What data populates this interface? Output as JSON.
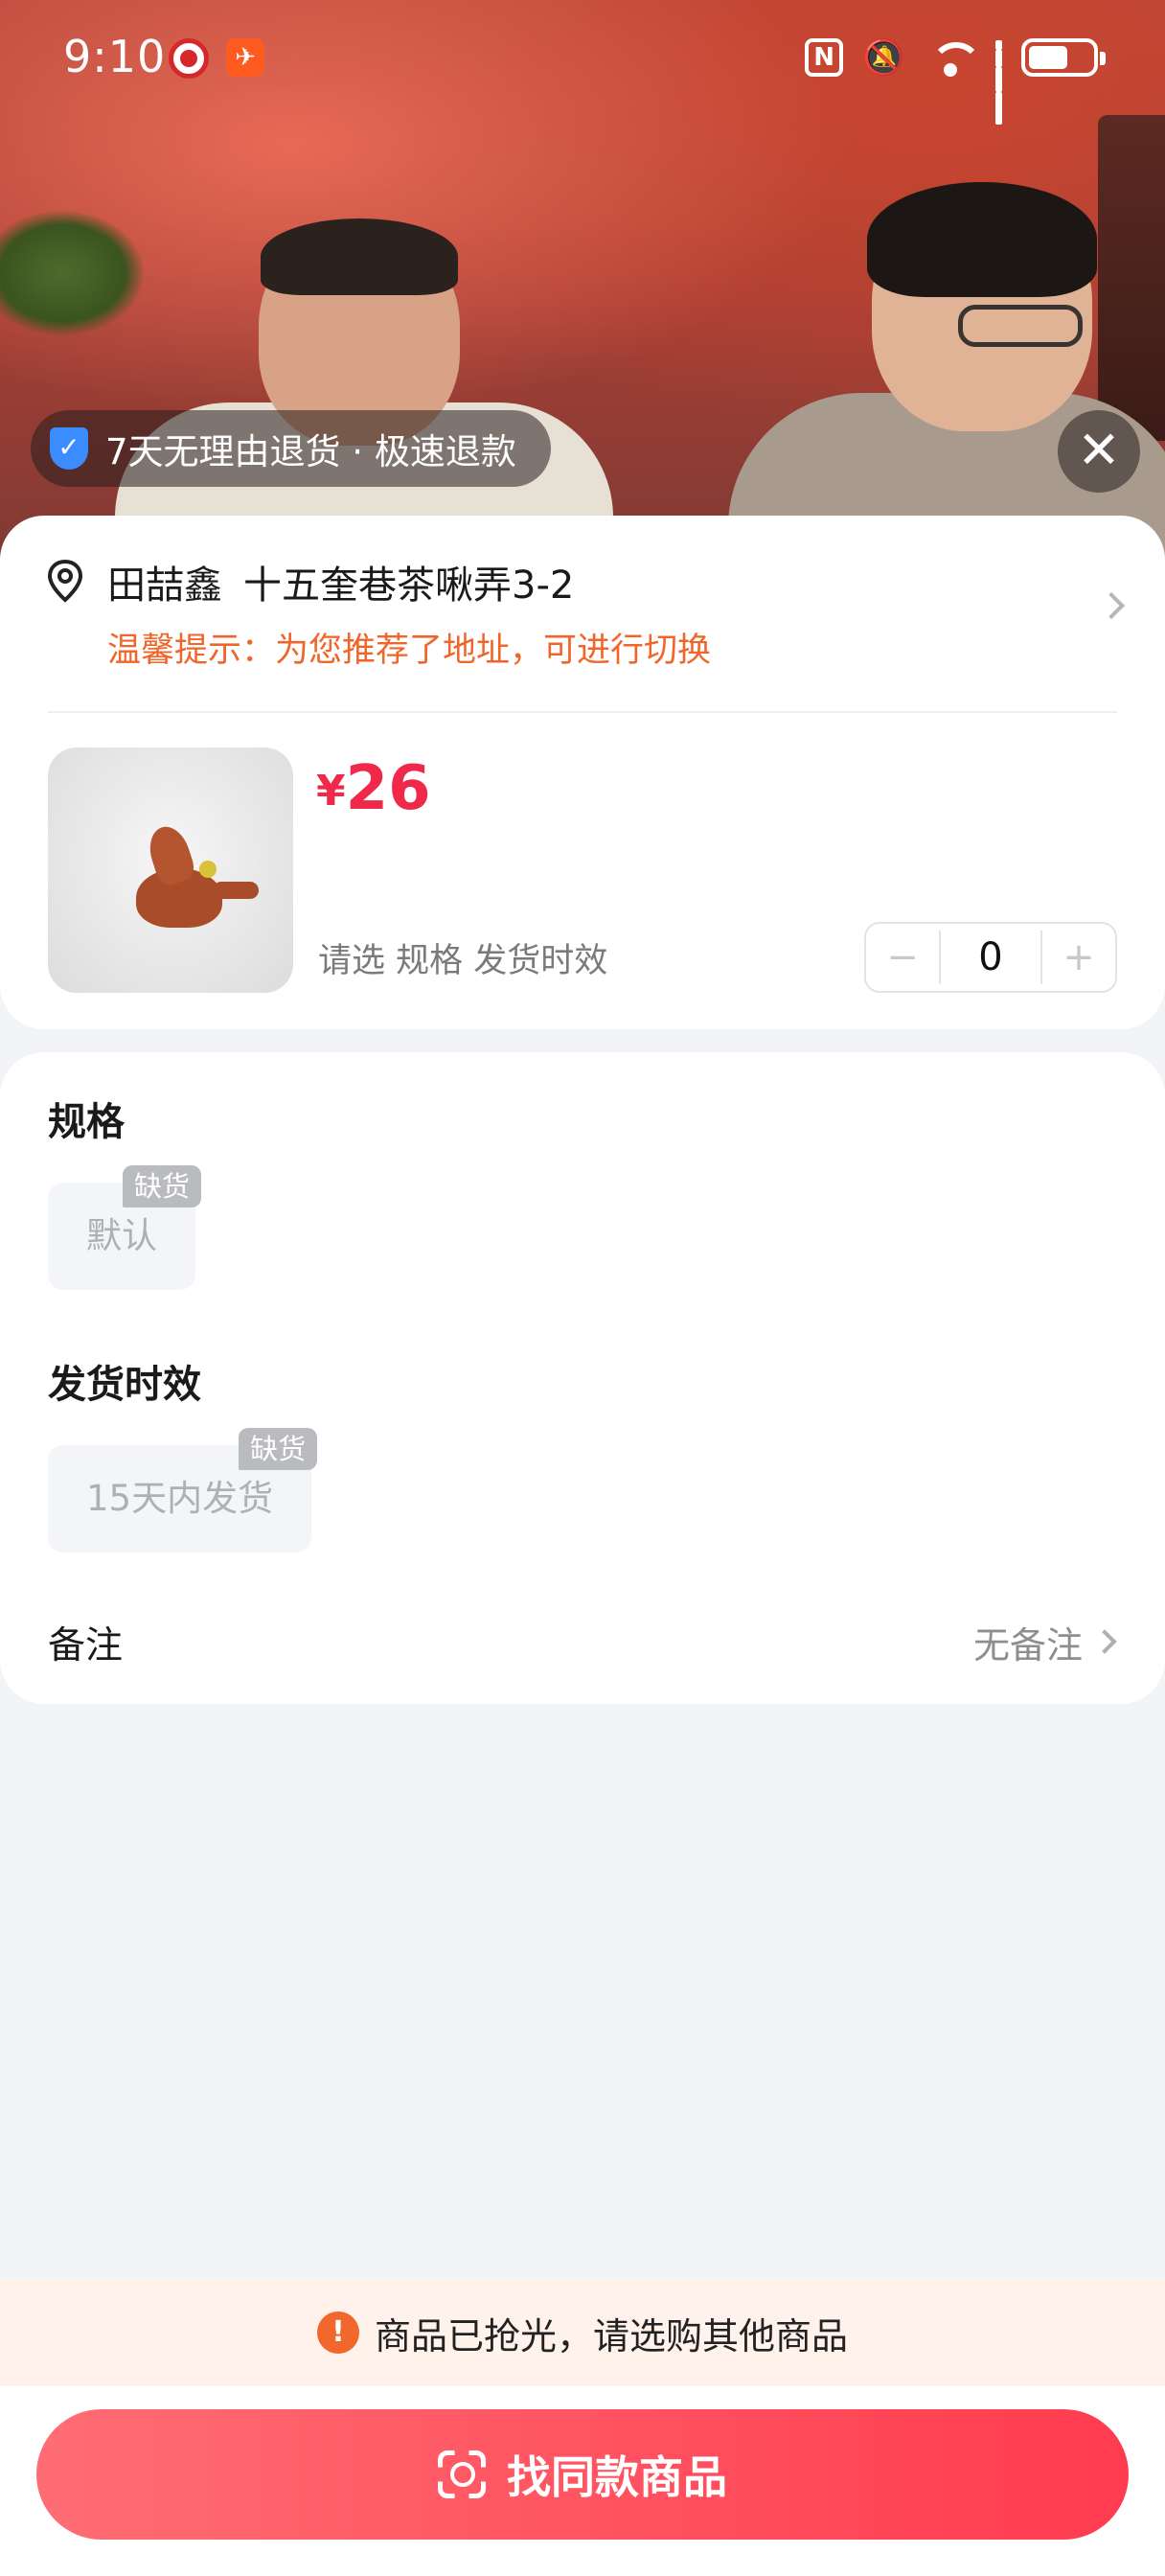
{
  "status_bar": {
    "time": "9:10",
    "icons": [
      "china-citic-app-icon",
      "orange-app-icon",
      "nfc-icon",
      "mute-bell-icon",
      "wifi-icon",
      "signal-icon",
      "battery-icon"
    ]
  },
  "video": {
    "return_badge": "7天无理由退货 · 极速退款",
    "close_icon": "close-icon"
  },
  "address": {
    "name": "田喆鑫",
    "detail": "十五奎巷茶啾弄3-2",
    "tip": "温馨提示：为您推荐了地址，可进行切换"
  },
  "product": {
    "currency": "¥",
    "price": "26",
    "spec_hint": "请选 规格 发货时效",
    "quantity": "0",
    "minus": "−",
    "plus": "+"
  },
  "spec": {
    "title": "规格",
    "option": "默认",
    "option_badge": "缺货",
    "ship_title": "发货时效",
    "ship_option": "15天内发货",
    "ship_badge": "缺货",
    "remark_label": "备注",
    "remark_value": "无备注"
  },
  "notice": {
    "icon": "!",
    "text": "商品已抢光，请选购其他商品"
  },
  "cta": {
    "label": "找同款商品"
  },
  "colors": {
    "price": "#f0284a",
    "tip": "#f0652a",
    "cta_start": "#ff6d74",
    "cta_end": "#ff3b4f",
    "notice_bg": "#fff2ea"
  }
}
